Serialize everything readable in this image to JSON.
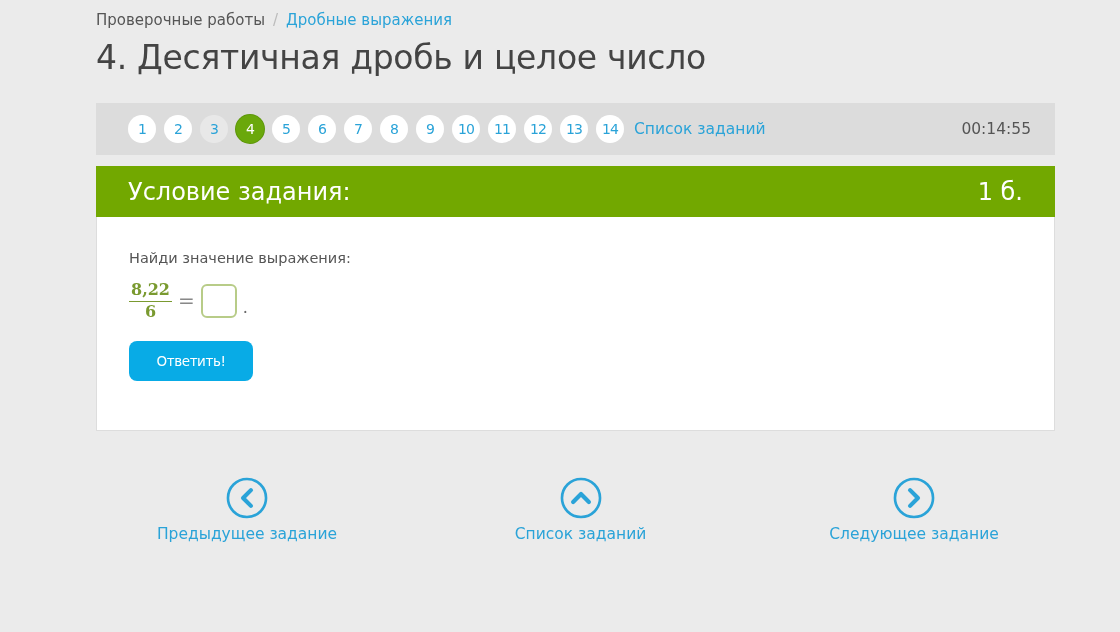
{
  "breadcrumb": [
    {
      "label": "Проверочные работы",
      "link": false
    },
    {
      "label": "Дробные выражения",
      "link": true
    }
  ],
  "separator": "/",
  "title": "4. Десятичная дробь и целое число",
  "tasks": [
    {
      "label": "1",
      "selected": false,
      "done": false
    },
    {
      "label": "2",
      "selected": false,
      "done": false
    },
    {
      "label": "3",
      "selected": false,
      "done": true
    },
    {
      "label": "4",
      "selected": true,
      "done": false
    },
    {
      "label": "5",
      "selected": false,
      "done": false
    },
    {
      "label": "6",
      "selected": false,
      "done": false
    },
    {
      "label": "7",
      "selected": false,
      "done": false
    },
    {
      "label": "8",
      "selected": false,
      "done": false
    },
    {
      "label": "9",
      "selected": false,
      "done": false
    },
    {
      "label": "10",
      "selected": false,
      "done": false
    },
    {
      "label": "11",
      "selected": false,
      "done": false
    },
    {
      "label": "12",
      "selected": false,
      "done": false
    },
    {
      "label": "13",
      "selected": false,
      "done": false
    },
    {
      "label": "14",
      "selected": false,
      "done": false
    }
  ],
  "task_list_link": "Список заданий",
  "timer": "00:14:55",
  "panel": {
    "heading": "Условие задания:",
    "points": "1 б.",
    "prompt": "Найди значение выражения:",
    "numerator": "8,22",
    "denominator": "6",
    "equals": "=",
    "period": ".",
    "submit": "Ответить!"
  },
  "nav": [
    {
      "kind": "left",
      "label": "Предыдущее задание"
    },
    {
      "kind": "up",
      "label": "Список заданий"
    },
    {
      "kind": "right",
      "label": "Следующее задание"
    }
  ]
}
